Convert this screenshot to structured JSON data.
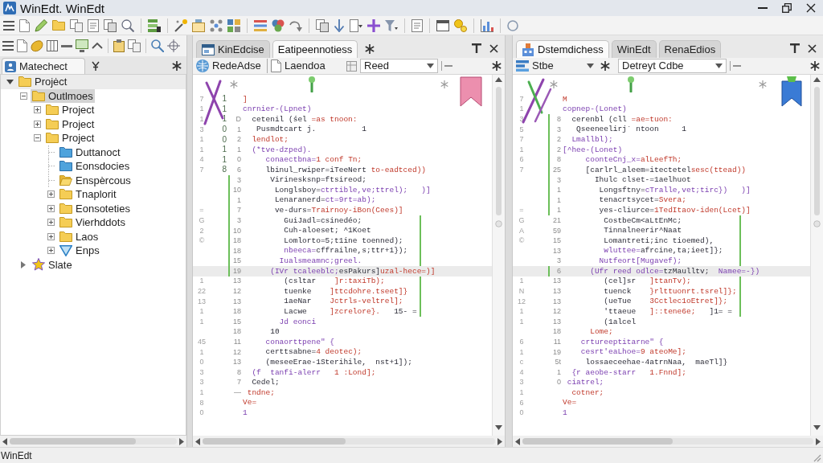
{
  "window": {
    "title": "WinEdt. WinEdt"
  },
  "left_panel": {
    "tab": "Matechect",
    "tree": [
      {
        "label": "Projėct",
        "kind": "folder",
        "expanded": true,
        "selected": false,
        "hovered": true,
        "children": [
          {
            "label": "Outlmoes",
            "kind": "folder",
            "expanded": true,
            "selected": true,
            "hovered": false,
            "children": [
              {
                "label": "Project",
                "kind": "folder",
                "expanded": false,
                "selected": false,
                "hovered": false
              },
              {
                "label": "Project",
                "kind": "folder",
                "expanded": false,
                "selected": false,
                "hovered": false
              },
              {
                "label": "Project",
                "kind": "folder",
                "expanded": true,
                "selected": false,
                "hovered": false,
                "children": [
                  {
                    "label": "Duttanoct",
                    "kind": "module",
                    "selected": false,
                    "hovered": false
                  },
                  {
                    "label": "Eonsdocies",
                    "kind": "module",
                    "selected": false,
                    "hovered": false
                  },
                  {
                    "label": "Enspèrcous",
                    "kind": "open_folder",
                    "selected": false,
                    "hovered": false
                  },
                  {
                    "label": "Tnaplorit",
                    "kind": "folder",
                    "expanded": false,
                    "selected": false,
                    "hovered": false
                  },
                  {
                    "label": "Eonsoteties",
                    "kind": "folder",
                    "expanded": false,
                    "selected": false,
                    "hovered": false
                  },
                  {
                    "label": "Vierhddots",
                    "kind": "folder",
                    "expanded": false,
                    "selected": false,
                    "hovered": false
                  },
                  {
                    "label": "Laos",
                    "kind": "folder",
                    "expanded": false,
                    "selected": false,
                    "hovered": false
                  },
                  {
                    "label": "Enps",
                    "kind": "filter",
                    "expanded": false,
                    "selected": false,
                    "hovered": false
                  }
                ]
              }
            ]
          },
          {
            "label": "Slate",
            "kind": "tag",
            "expanded": false,
            "selected": false,
            "hovered": false
          }
        ]
      }
    ]
  },
  "editors": [
    {
      "tabs": [
        {
          "label": "KinEdcise",
          "selected": false
        },
        {
          "label": "Eatipeennotiess",
          "selected": true
        }
      ],
      "toolbar": {
        "button": {
          "label": "RedeAdse",
          "kind": "plain"
        },
        "file": "Laendoa",
        "dropdown": "Reed"
      },
      "lines": [
        {
          "gutter": "7",
          "mark": "1",
          "changed": false,
          "bracket": false,
          "current": false,
          "segments": [
            {
              "text": "]",
              "kind": "value"
            }
          ]
        },
        {
          "gutter": "1",
          "mark": "1",
          "changed": false,
          "bracket": false,
          "current": false,
          "segments": [
            {
              "text": "cnrnier-(Lpnet)",
              "kind": "keyword"
            }
          ]
        },
        {
          "gutter": "1",
          "mark": "1",
          "number": "D",
          "changed": false,
          "bracket": false,
          "current": false,
          "segments": [
            {
              "text": "  cetenil (śel ",
              "kind": "plain"
            },
            {
              "text": "=as tnoon:",
              "kind": "value"
            }
          ]
        },
        {
          "gutter": "3",
          "mark": "0",
          "number": "1",
          "changed": false,
          "bracket": false,
          "current": false,
          "segments": [
            {
              "text": "   Pusmdtcart j.          1",
              "kind": "plain"
            }
          ]
        },
        {
          "gutter": "1",
          "mark": "0",
          "number": "2",
          "changed": false,
          "bracket": false,
          "current": false,
          "segments": [
            {
              "text": "  lendlot;",
              "kind": "value"
            }
          ]
        },
        {
          "gutter": "1",
          "mark": "1",
          "number": "1",
          "changed": false,
          "bracket": false,
          "current": false,
          "segments": [
            {
              "text": "  (*tve-dzped).",
              "kind": "keyword"
            }
          ]
        },
        {
          "gutter": "4",
          "mark": "1",
          "number": "0",
          "changed": false,
          "bracket": false,
          "current": false,
          "segments": [
            {
              "text": "     conaectbna=",
              "kind": "keyword"
            },
            {
              "text": "1 conf Tn;",
              "kind": "value"
            }
          ]
        },
        {
          "gutter": "7",
          "mark": "8",
          "number": "6",
          "changed": false,
          "bracket": false,
          "current": false,
          "segments": [
            {
              "text": "     lbinul_rwiper=iTeeNert ",
              "kind": "plain"
            },
            {
              "text": "to-eadtced))",
              "kind": "value"
            }
          ]
        },
        {
          "number": "3",
          "changed": true,
          "bracket": false,
          "current": false,
          "segments": [
            {
              "text": "      Virinesksnp=ftsireod;",
              "kind": "plain"
            }
          ]
        },
        {
          "number": "10",
          "changed": true,
          "bracket": false,
          "current": false,
          "segments": [
            {
              "text": "       Longlsboy=",
              "kind": "plain"
            },
            {
              "text": "ctrtible,ve;ttrel);   )]",
              "kind": "keyword"
            }
          ]
        },
        {
          "number": "1",
          "changed": true,
          "bracket": false,
          "current": false,
          "segments": [
            {
              "text": "       Lenaranerd=",
              "kind": "plain"
            },
            {
              "text": "ct=9rt=ab);",
              "kind": "keyword"
            }
          ]
        },
        {
          "gutter": "=",
          "number": "7",
          "changed": true,
          "bracket": false,
          "current": false,
          "segments": [
            {
              "text": "       ve-durs=",
              "kind": "plain"
            },
            {
              "text": "Trairnoy-iBon(Cees)]",
              "kind": "value"
            }
          ]
        },
        {
          "gutter": "G",
          "number": "3",
          "changed": true,
          "bracket": true,
          "current": false,
          "segments": [
            {
              "text": "         GuiJadl=csinedéo;",
              "kind": "plain"
            }
          ]
        },
        {
          "gutter": "2",
          "number": "10",
          "changed": true,
          "bracket": true,
          "current": false,
          "segments": [
            {
              "text": "         Cuh-aloeset; ^1Koet",
              "kind": "plain"
            }
          ]
        },
        {
          "gutter": "©",
          "number": "18",
          "changed": true,
          "bracket": true,
          "current": false,
          "segments": [
            {
              "text": "         Lomlorto=5;t1ine toenned);",
              "kind": "plain"
            }
          ]
        },
        {
          "number": "18",
          "changed": true,
          "bracket": true,
          "current": false,
          "segments": [
            {
              "text": "         nbeeca=",
              "kind": "keyword"
            },
            {
              "text": "cffrailne,s;ttr+1});",
              "kind": "plain"
            }
          ]
        },
        {
          "number": "15",
          "changed": true,
          "bracket": true,
          "current": false,
          "segments": [
            {
              "text": "        Iualsmeamnc;greel.",
              "kind": "keyword"
            }
          ]
        },
        {
          "number": "19",
          "changed": true,
          "bracket": false,
          "current": true,
          "segments": [
            {
              "text": "      (IVr tcaleeblc;",
              "kind": "keyword"
            },
            {
              "text": "esPakurs]",
              "kind": "plain"
            },
            {
              "text": "uzal-hece=)]",
              "kind": "value"
            }
          ]
        },
        {
          "gutter": "1",
          "number": "13",
          "changed": false,
          "bracket": true,
          "current": false,
          "segments": [
            {
              "text": "         (csltar    ",
              "kind": "plain"
            },
            {
              "text": "]r:taxiTb);",
              "kind": "value"
            }
          ]
        },
        {
          "gutter": "22",
          "number": "12",
          "changed": false,
          "bracket": true,
          "current": false,
          "segments": [
            {
              "text": "         tuenke    ",
              "kind": "plain"
            },
            {
              "text": "]ttcdohre.tseet]}",
              "kind": "value"
            }
          ]
        },
        {
          "gutter": "13",
          "number": "13",
          "changed": false,
          "bracket": true,
          "current": false,
          "segments": [
            {
              "text": "         1aeNar    ",
              "kind": "plain"
            },
            {
              "text": "Jctrls-veltrel];",
              "kind": "value"
            }
          ]
        },
        {
          "gutter": "1",
          "number": "18",
          "changed": false,
          "bracket": true,
          "current": false,
          "segments": [
            {
              "text": "         Lacwe     ",
              "kind": "plain"
            },
            {
              "text": "]zcrelore}.",
              "kind": "value"
            },
            {
              "text": "   15- =",
              "kind": "plain"
            }
          ]
        },
        {
          "gutter": "1",
          "number": "15",
          "changed": false,
          "bracket": false,
          "current": false,
          "segments": [
            {
              "text": "        Jd eonci",
              "kind": "keyword"
            }
          ]
        },
        {
          "number": "18",
          "changed": false,
          "bracket": false,
          "current": false,
          "segments": [
            {
              "text": "      10",
              "kind": "plain"
            }
          ]
        },
        {
          "gutter": "45",
          "number": "11",
          "changed": false,
          "bracket": false,
          "current": false,
          "segments": [
            {
              "text": "     conaorttpene\" {",
              "kind": "keyword"
            }
          ]
        },
        {
          "gutter": "1",
          "number": "12",
          "changed": false,
          "bracket": false,
          "current": false,
          "segments": [
            {
              "text": "     certtsabne=",
              "kind": "plain"
            },
            {
              "text": "4 deotec);",
              "kind": "value"
            }
          ]
        },
        {
          "gutter": "0",
          "number": "13",
          "changed": false,
          "bracket": false,
          "current": false,
          "segments": [
            {
              "text": "     (meseeErae-1Sterihile,  nst+1]);",
              "kind": "plain"
            }
          ]
        },
        {
          "gutter": "3",
          "number": "8",
          "changed": false,
          "bracket": false,
          "current": false,
          "segments": [
            {
              "text": "  (f  tanfi-alerr   ",
              "kind": "keyword"
            },
            {
              "text": "1 :Lond];",
              "kind": "value"
            }
          ]
        },
        {
          "gutter": "3",
          "number": "7",
          "changed": false,
          "bracket": false,
          "current": false,
          "segments": [
            {
              "text": "  Cedel;",
              "kind": "plain"
            }
          ]
        },
        {
          "gutter": "1",
          "number": "—",
          "changed": false,
          "bracket": false,
          "current": false,
          "segments": [
            {
              "text": " tndne;",
              "kind": "value"
            }
          ]
        },
        {
          "gutter": "8",
          "changed": false,
          "bracket": false,
          "current": false,
          "segments": [
            {
              "text": "Ve=",
              "kind": "value"
            }
          ]
        },
        {
          "gutter": "0",
          "changed": false,
          "bracket": false,
          "current": false,
          "segments": [
            {
              "text": "1",
              "kind": "keyword"
            }
          ]
        }
      ]
    },
    {
      "tabs": [
        {
          "label": "Dstemdichess",
          "selected": true
        },
        {
          "label": "WinEdt",
          "selected": false
        },
        {
          "label": "RenaEdios",
          "selected": false
        }
      ],
      "toolbar": {
        "button": {
          "label": "Stbe",
          "kind": "menu"
        },
        "dropdown": "Detreyt Cdbe"
      },
      "lines": [
        {
          "gutter": "7",
          "changed": false,
          "bracket": false,
          "current": false,
          "segments": [
            {
              "text": "M",
              "kind": "value"
            }
          ]
        },
        {
          "gutter": "1",
          "changed": false,
          "bracket": false,
          "current": false,
          "segments": [
            {
              "text": "copnep-(Lonet)",
              "kind": "keyword"
            }
          ]
        },
        {
          "gutter": "3",
          "number": "8",
          "changed": true,
          "bracket": false,
          "current": false,
          "segments": [
            {
              "text": "  cerenbl (cll ",
              "kind": "plain"
            },
            {
              "text": "=ae=tuon:",
              "kind": "value"
            }
          ]
        },
        {
          "gutter": "5",
          "number": "3",
          "changed": true,
          "bracket": false,
          "current": false,
          "segments": [
            {
              "text": "   Qseeneelirj` ntoon     1",
              "kind": "plain"
            }
          ]
        },
        {
          "gutter": "7",
          "number": "2",
          "changed": true,
          "bracket": false,
          "current": false,
          "segments": [
            {
              "text": "  Lmallbl);",
              "kind": "keyword"
            }
          ]
        },
        {
          "gutter": "1",
          "number": "2",
          "changed": true,
          "bracket": false,
          "current": false,
          "segments": [
            {
              "text": "[^hee-(Lonet)",
              "kind": "keyword"
            }
          ]
        },
        {
          "gutter": "6",
          "number": "8",
          "changed": true,
          "bracket": false,
          "current": false,
          "segments": [
            {
              "text": "     coonteCnj_x=",
              "kind": "keyword"
            },
            {
              "text": "alLeefTh;",
              "kind": "value"
            }
          ]
        },
        {
          "gutter": "7",
          "number": "25",
          "changed": true,
          "bracket": false,
          "current": false,
          "segments": [
            {
              "text": "     [carlrl_aleem=itectetel",
              "kind": "plain"
            },
            {
              "text": "sesc(ttead))",
              "kind": "value"
            }
          ]
        },
        {
          "number": "3",
          "changed": true,
          "bracket": false,
          "current": false,
          "segments": [
            {
              "text": "       Ihulc clset-=1aelhuot",
              "kind": "plain"
            }
          ]
        },
        {
          "number": "1",
          "changed": true,
          "bracket": false,
          "current": false,
          "segments": [
            {
              "text": "        Longsftny=",
              "kind": "plain"
            },
            {
              "text": "cTralle,vet;tirc})   )]",
              "kind": "keyword"
            }
          ]
        },
        {
          "number": "1",
          "changed": true,
          "bracket": false,
          "current": false,
          "segments": [
            {
              "text": "        tenacrtsycet=",
              "kind": "plain"
            },
            {
              "text": "Svera;",
              "kind": "value"
            }
          ]
        },
        {
          "gutter": "=",
          "number": "1",
          "changed": true,
          "bracket": false,
          "current": false,
          "segments": [
            {
              "text": "        yes-cliurce=",
              "kind": "plain"
            },
            {
              "text": "1TedItaov-iden(Lcet)]",
              "kind": "value"
            }
          ]
        },
        {
          "gutter": "G",
          "number": "21",
          "changed": false,
          "bracket": true,
          "current": false,
          "segments": [
            {
              "text": "         CostbeCm<aLtEnMc;",
              "kind": "plain"
            }
          ]
        },
        {
          "gutter": "A",
          "number": "59",
          "changed": false,
          "bracket": true,
          "current": false,
          "segments": [
            {
              "text": "         Tinnalneerir^Naat",
              "kind": "plain"
            }
          ]
        },
        {
          "gutter": "©",
          "number": "15",
          "changed": false,
          "bracket": true,
          "current": false,
          "segments": [
            {
              "text": "         Lomantreti;inc tioemed),",
              "kind": "plain"
            }
          ]
        },
        {
          "number": "13",
          "changed": false,
          "bracket": true,
          "current": false,
          "segments": [
            {
              "text": "         wluttee=",
              "kind": "keyword"
            },
            {
              "text": "afrcine,ta;ieet]};",
              "kind": "plain"
            }
          ]
        },
        {
          "number": "3",
          "changed": false,
          "bracket": true,
          "current": false,
          "segments": [
            {
              "text": "        Nutfeort[Mugavef);",
              "kind": "keyword"
            }
          ]
        },
        {
          "number": "6",
          "changed": true,
          "bracket": false,
          "current": true,
          "segments": [
            {
              "text": "      (Ufr reed odlce=",
              "kind": "keyword"
            },
            {
              "text": "tzMaulltv;  ",
              "kind": "plain"
            },
            {
              "text": "Namee=-})",
              "kind": "keyword"
            }
          ]
        },
        {
          "gutter": "1",
          "number": "13",
          "changed": false,
          "bracket": true,
          "current": false,
          "segments": [
            {
              "text": "         (cel]sr   ",
              "kind": "plain"
            },
            {
              "text": "]ttanTv);",
              "kind": "value"
            }
          ]
        },
        {
          "gutter": "N",
          "number": "13",
          "changed": false,
          "bracket": true,
          "current": false,
          "segments": [
            {
              "text": "         tuenck    ",
              "kind": "plain"
            },
            {
              "text": "}rlttuonrt.tsrel]};",
              "kind": "value"
            }
          ]
        },
        {
          "gutter": "12",
          "number": "13",
          "changed": false,
          "bracket": true,
          "current": false,
          "segments": [
            {
              "text": "         (ueTue    ",
              "kind": "plain"
            },
            {
              "text": "3Cctlec1oEtret]};",
              "kind": "value"
            }
          ]
        },
        {
          "gutter": "1",
          "number": "12",
          "changed": false,
          "bracket": true,
          "current": false,
          "segments": [
            {
              "text": "         'ttaeue   ",
              "kind": "plain"
            },
            {
              "text": "]::tene6e;",
              "kind": "value"
            },
            {
              "text": "   ]1= =",
              "kind": "plain"
            }
          ]
        },
        {
          "gutter": "1",
          "number": "13",
          "changed": false,
          "bracket": false,
          "current": false,
          "segments": [
            {
              "text": "         (1alcel",
              "kind": "plain"
            }
          ]
        },
        {
          "number": "18",
          "changed": false,
          "bracket": false,
          "current": false,
          "segments": [
            {
              "text": "      Lome;",
              "kind": "value"
            }
          ]
        },
        {
          "gutter": "6",
          "number": "11",
          "changed": false,
          "bracket": false,
          "current": false,
          "segments": [
            {
              "text": "    crtureeptitarne\" {",
              "kind": "keyword"
            }
          ]
        },
        {
          "gutter": "1",
          "number": "19",
          "changed": false,
          "bracket": false,
          "current": false,
          "segments": [
            {
              "text": "    cesrt'eaLhoe=",
              "kind": "keyword"
            },
            {
              "text": "9 ateoMe];",
              "kind": "value"
            }
          ]
        },
        {
          "gutter": "c",
          "number": "5t",
          "changed": false,
          "bracket": false,
          "current": false,
          "segments": [
            {
              "text": "     lossaeceehae-4atrnNaa,  maeTl]}",
              "kind": "plain"
            }
          ]
        },
        {
          "gutter": "4",
          "number": "1",
          "changed": false,
          "bracket": false,
          "current": false,
          "segments": [
            {
              "text": "  {r aeobe-starr   ",
              "kind": "keyword"
            },
            {
              "text": "1.Fnnd];",
              "kind": "value"
            }
          ]
        },
        {
          "gutter": "3",
          "number": "0",
          "changed": false,
          "bracket": false,
          "current": false,
          "segments": [
            {
              "text": " ciatrel;",
              "kind": "keyword"
            }
          ]
        },
        {
          "gutter": "1",
          "changed": false,
          "bracket": false,
          "current": false,
          "segments": [
            {
              "text": "  cotner;",
              "kind": "value"
            }
          ]
        },
        {
          "gutter": "6",
          "changed": false,
          "bracket": false,
          "current": false,
          "segments": [
            {
              "text": "Ve=",
              "kind": "value"
            }
          ]
        },
        {
          "gutter": "0",
          "changed": false,
          "bracket": false,
          "current": false,
          "segments": [
            {
              "text": "1",
              "kind": "keyword"
            }
          ]
        }
      ]
    }
  ],
  "status_bar": {
    "text": "WinEdt"
  }
}
